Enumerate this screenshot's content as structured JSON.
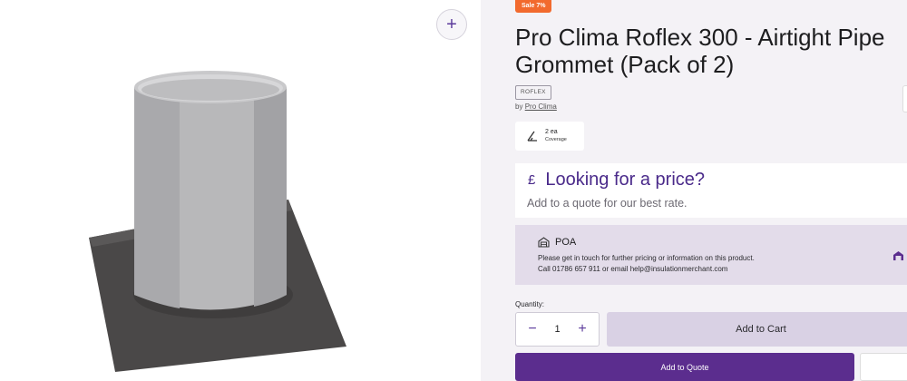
{
  "gallery": {
    "zoom_icon": "plus-icon",
    "product_image": "pipe-grommet-product"
  },
  "product": {
    "sale_badge": "Sale 7%",
    "title": "Pro Clima Roflex 300 - Airtight Pipe Grommet (Pack of 2)",
    "brand_tag": "ROFLEX",
    "by_prefix": "by",
    "brand_link": "Pro Clima",
    "coverage": {
      "value": "2 ea",
      "label": "Coverage",
      "icon": "ruler-triangle-icon"
    }
  },
  "price": {
    "currency_symbol": "£",
    "heading": "Looking for a price?",
    "subtext": "Add to a quote for our best rate."
  },
  "poa": {
    "icon": "warehouse-icon",
    "heading": "POA",
    "line1": "Please get in touch for further pricing or information on this product.",
    "line2": "Call 01786 657 911 or email help@insulationmerchant.com"
  },
  "purchase": {
    "quantity_label": "Quantity:",
    "quantity_value": "1",
    "minus": "−",
    "plus": "+",
    "add_to_cart": "Add to Cart",
    "add_to_quote": "Add to Quote"
  },
  "colors": {
    "brand_purple": "#5b2d8e",
    "sale_orange": "#f26a2e",
    "poa_bg": "#e3dcea",
    "cart_bg": "#d9d1e4"
  }
}
